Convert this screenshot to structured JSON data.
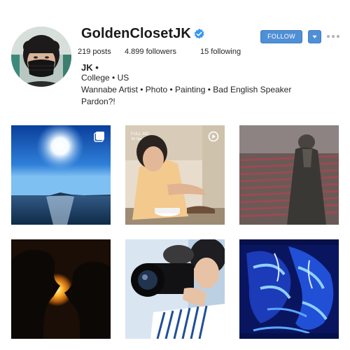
{
  "profile": {
    "username": "GoldenClosetJK",
    "verified_icon": "verified-badge-icon",
    "stats": {
      "posts": "219 posts",
      "followers": "4.899 followers",
      "following": "15 following"
    },
    "bio": {
      "name": "JK •",
      "line1": "College • US",
      "line2": "Wannabe Artist • Photo • Painting • Bad English Speaker",
      "line3": "Pardon?!"
    }
  },
  "actions": {
    "follow_label": "FOLLOW",
    "dropdown_icon": "triangle-down-icon",
    "more_icon": "ellipsis-icon"
  },
  "posts": [
    {
      "id": "post-1",
      "subject": "sun over sea horizon",
      "badge": "multiple-images-icon"
    },
    {
      "id": "post-2",
      "subject": "person cooking video",
      "badge": "video-icon",
      "overlay_top": "FULL HD",
      "overlay_fps": "30 fps"
    },
    {
      "id": "post-3",
      "subject": "person in stadium seats"
    },
    {
      "id": "post-4",
      "subject": "couple silhouette at sunset"
    },
    {
      "id": "post-5",
      "subject": "person holding camera"
    },
    {
      "id": "post-6",
      "subject": "blue abstract painting"
    }
  ],
  "colors": {
    "accent": "#4f8fd6",
    "text": "#262626",
    "verified": "#3897f0"
  }
}
